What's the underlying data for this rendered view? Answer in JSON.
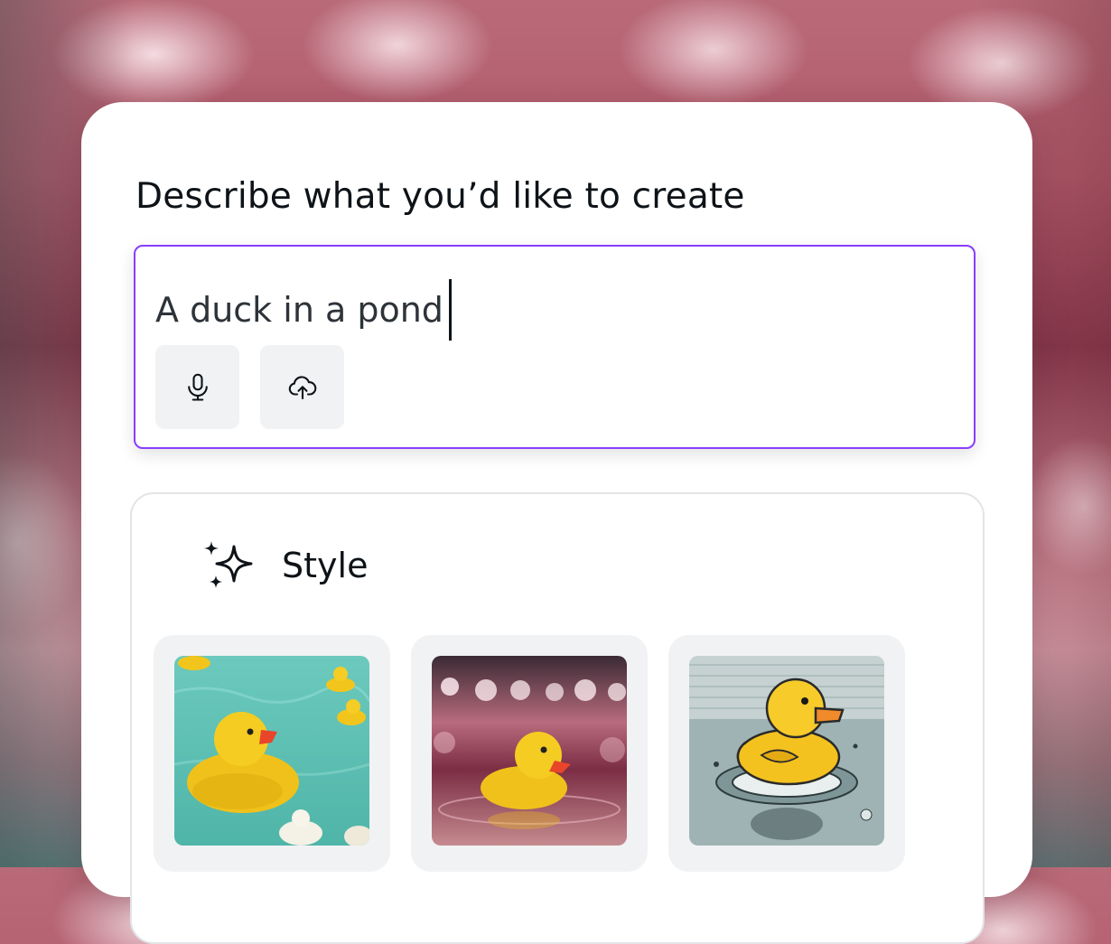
{
  "heading": "Describe what you’d like to create",
  "prompt": {
    "value": "A duck in a pond",
    "accent_color": "#8b3dff"
  },
  "tools": {
    "voice_icon": "microphone-icon",
    "upload_icon": "cloud-upload-icon"
  },
  "style_section": {
    "icon": "sparkles-icon",
    "title": "Style",
    "options": [
      {
        "name": "rubber-ducks-photo"
      },
      {
        "name": "rubber-duck-bokeh"
      },
      {
        "name": "illustrated-duck"
      }
    ]
  }
}
